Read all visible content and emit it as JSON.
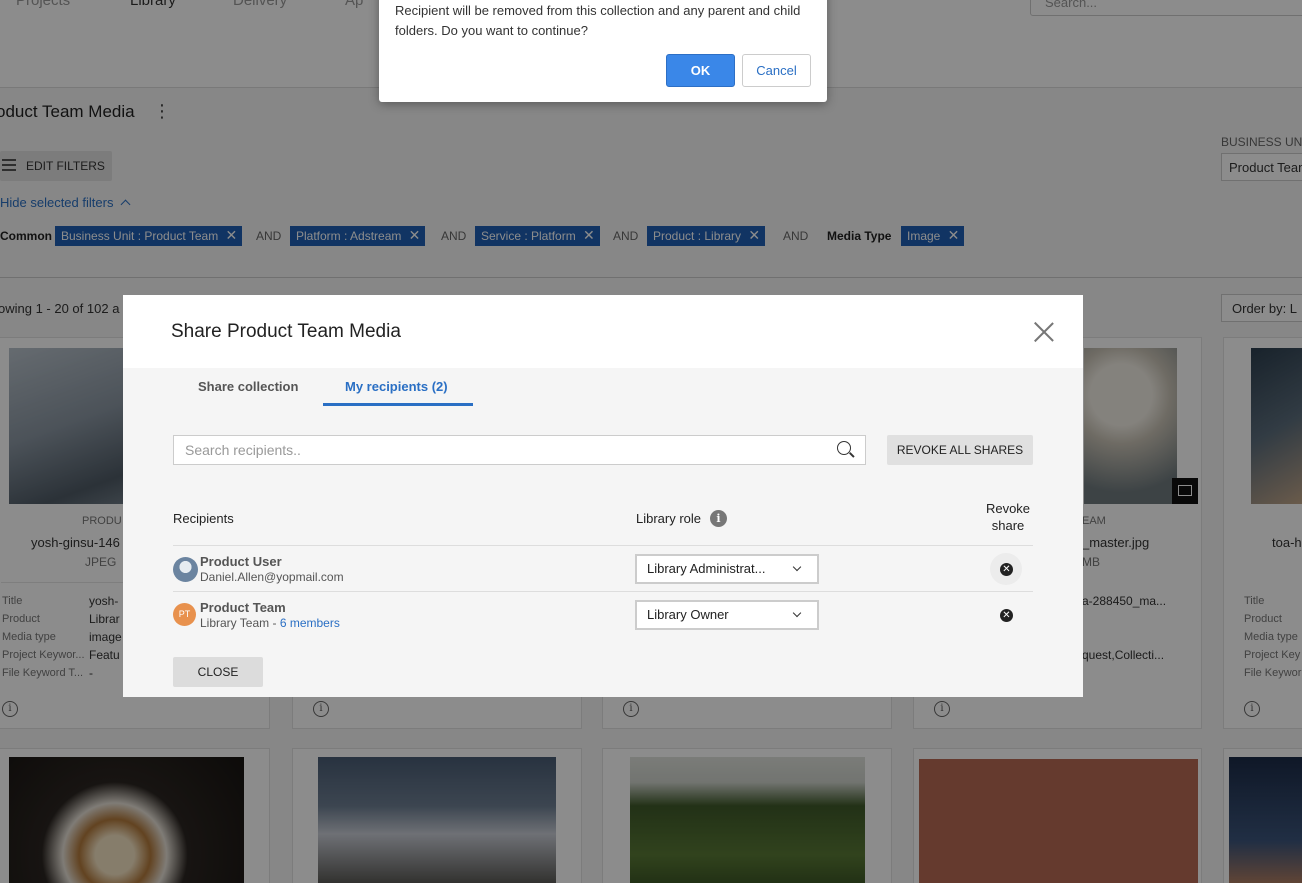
{
  "topnav": {
    "items": [
      "Projects",
      "Library",
      "Delivery",
      "Ap"
    ],
    "search_placeholder": "Search..."
  },
  "page": {
    "title": "oduct Team Media",
    "kebab": "⋮",
    "edit_filters": "EDIT FILTERS",
    "business_unit_label": "BUSINESS UNI",
    "business_unit_value": "Product Team",
    "hide_filters": "Hide selected filters",
    "filter_common": "Common",
    "filters": [
      "Business Unit : Product Team",
      "Platform : Adstream",
      "Service : Platform",
      "Product : Library",
      "Image"
    ],
    "and_label": "AND",
    "media_type_label": "Media Type",
    "showing": "owing 1 - 20 of 102 a",
    "order_by": "Order by: L"
  },
  "cards": {
    "c1": {
      "category": "PRODU",
      "filename": "yosh-ginsu-146",
      "format": "JPEG",
      "keys": [
        "Title",
        "Product",
        "Media type",
        "Project Keywor...",
        "File Keyword T..."
      ],
      "vals": [
        "yosh-",
        "Librar",
        "image",
        "Featu",
        "-"
      ]
    },
    "c4": {
      "category": "EAM",
      "filename": "_master.jpg",
      "size": "MB",
      "vals": [
        "a-288450_ma...",
        "",
        "",
        "quest,Collecti...",
        ""
      ]
    },
    "c5": {
      "filename": "toa-h",
      "keys": [
        "Title",
        "Product",
        "Media type",
        "Project Key",
        "File Keywor"
      ]
    },
    "info_glyph": "i"
  },
  "confirm": {
    "message": "Recipient will be removed from this collection and any parent and child folders. Do you want to continue?",
    "ok": "OK",
    "cancel": "Cancel"
  },
  "modal": {
    "title": "Share Product Team Media",
    "tabs": [
      "Share collection",
      "My recipients (2)"
    ],
    "search_placeholder": "Search recipients..",
    "revoke_all": "REVOKE ALL SHARES",
    "col_recipients": "Recipients",
    "col_role": "Library role",
    "col_revoke": "Revoke share",
    "info_glyph": "i",
    "recipients": [
      {
        "name": "Product User",
        "sub": "Daniel.Allen@yopmail.com",
        "role": "Library Administrat..."
      },
      {
        "name": "Product Team",
        "initials": "PT",
        "sub": "Library Team - ",
        "members": "6 members",
        "role": "Library Owner"
      }
    ],
    "close": "CLOSE"
  },
  "colors": {
    "accent": "#2a6fc4",
    "chip": "#1f5fb4",
    "ok_button": "#3a87e8",
    "avatar_orange": "#e8914d"
  }
}
